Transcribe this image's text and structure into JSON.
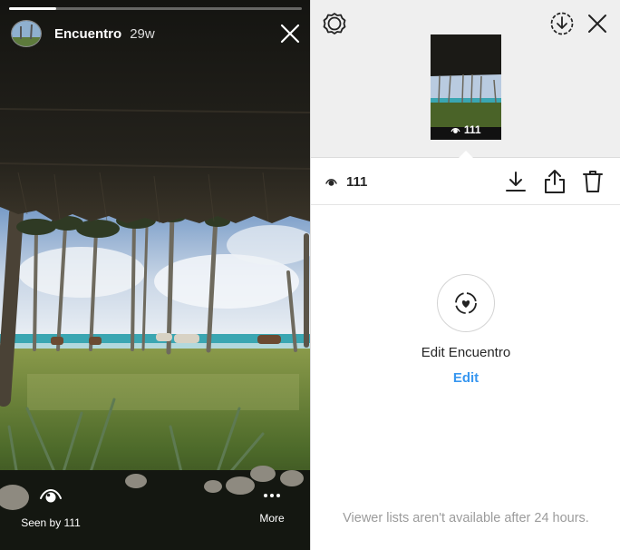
{
  "story": {
    "username": "Encuentro",
    "age": "29w",
    "progress": 0.16,
    "seen_by_label": "Seen by 111",
    "more_label": "More"
  },
  "insights": {
    "thumbnail_views": "111",
    "views": "111",
    "highlight_title": "Edit Encuentro",
    "highlight_edit": "Edit",
    "notice": "Viewer lists aren't available after 24 hours."
  },
  "icons": [
    "close-icon",
    "settings-gear-icon",
    "download-circle-icon",
    "eye-icon",
    "download-icon",
    "share-icon",
    "trash-icon",
    "highlight-heart-icon",
    "more-dots-icon"
  ],
  "colors": {
    "link": "#3897f0",
    "panel_top": "#efefef",
    "text": "#262626",
    "muted": "#9b9b9b"
  }
}
